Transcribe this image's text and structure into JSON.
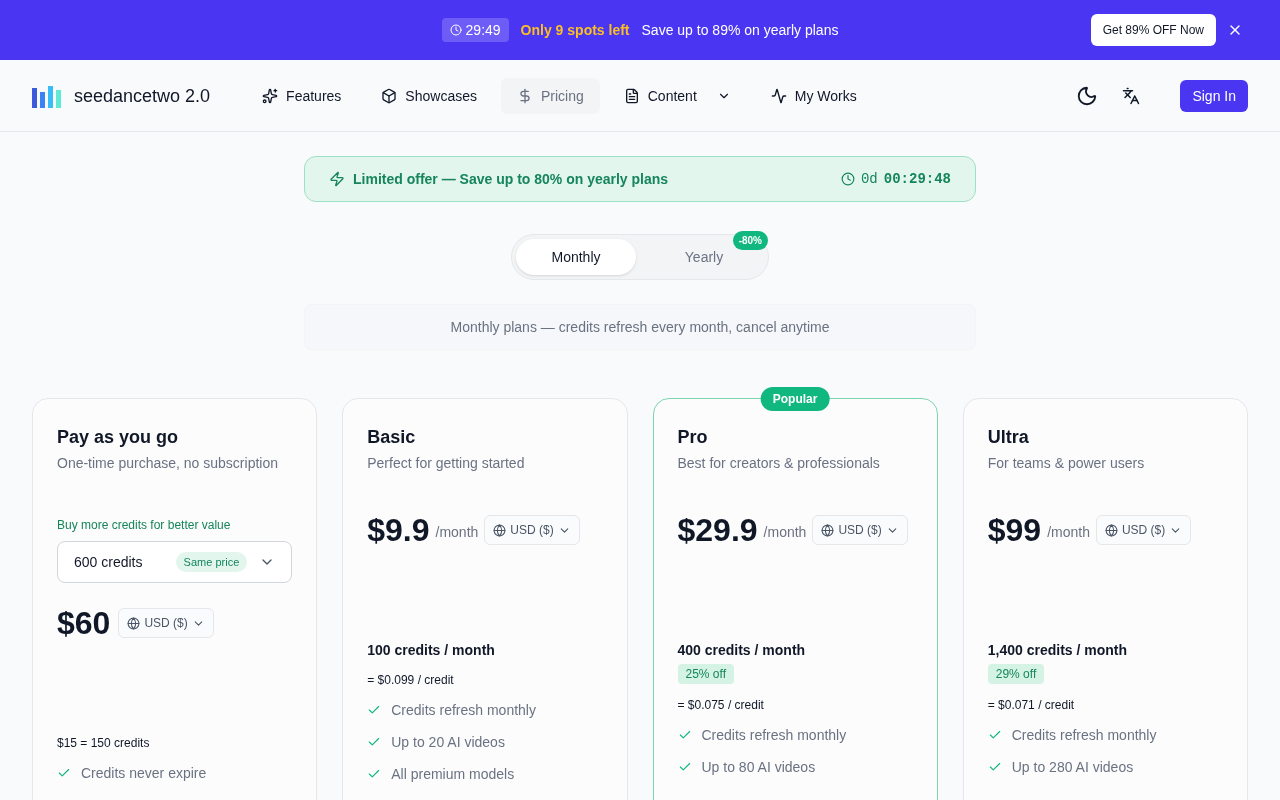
{
  "promo_bar": {
    "timer": "29:49",
    "spots": "Only 9 spots left",
    "message": "Save up to 89% on yearly plans",
    "cta": "Get 89% OFF Now"
  },
  "nav": {
    "brand": "seedancetwo 2.0",
    "items": [
      {
        "label": "Features",
        "selected": false,
        "dropdown": false
      },
      {
        "label": "Showcases",
        "selected": false,
        "dropdown": false
      },
      {
        "label": "Pricing",
        "selected": true,
        "dropdown": false
      },
      {
        "label": "Content",
        "selected": false,
        "dropdown": true
      },
      {
        "label": "My Works",
        "selected": false,
        "dropdown": false
      }
    ],
    "sign_in": "Sign In"
  },
  "offer": {
    "text": "Limited offer — Save up to 80% on yearly plans",
    "days": "0d",
    "time": "00:29:48"
  },
  "billing_tabs": [
    {
      "label": "Monthly",
      "selected": true
    },
    {
      "label": "Yearly",
      "selected": false,
      "badge": "-80%"
    }
  ],
  "billing_note": "Monthly plans — credits refresh every month, cancel anytime",
  "plans": [
    {
      "kind": "payg",
      "name": "Pay as you go",
      "description": "One-time purchase, no subscription",
      "hint": "Buy more credits for better value",
      "package": "600 credits",
      "package_tag": "Same price",
      "price": "$60",
      "currency": "USD ($)",
      "rate": "$15 = 150 credits",
      "features": [
        "Credits never expire"
      ]
    },
    {
      "kind": "subscription",
      "name": "Basic",
      "description": "Perfect for getting started",
      "price": "$9.9",
      "period": "/month",
      "currency": "USD ($)",
      "credits": "100 credits / month",
      "per_credit": "= $0.099 / credit",
      "features": [
        "Credits refresh monthly",
        "Up to 20 AI videos",
        "All premium models"
      ]
    },
    {
      "kind": "subscription",
      "name": "Pro",
      "description": "Best for creators & professionals",
      "badge": "Popular",
      "price": "$29.9",
      "period": "/month",
      "currency": "USD ($)",
      "credits": "400 credits / month",
      "discount": "25% off",
      "per_credit": "= $0.075 / credit",
      "features": [
        "Credits refresh monthly",
        "Up to 80 AI videos"
      ]
    },
    {
      "kind": "subscription",
      "name": "Ultra",
      "description": "For teams & power users",
      "price": "$99",
      "period": "/month",
      "currency": "USD ($)",
      "credits": "1,400 credits / month",
      "discount": "29% off",
      "per_credit": "= $0.071 / credit",
      "features": [
        "Credits refresh monthly",
        "Up to 280 AI videos"
      ]
    }
  ]
}
